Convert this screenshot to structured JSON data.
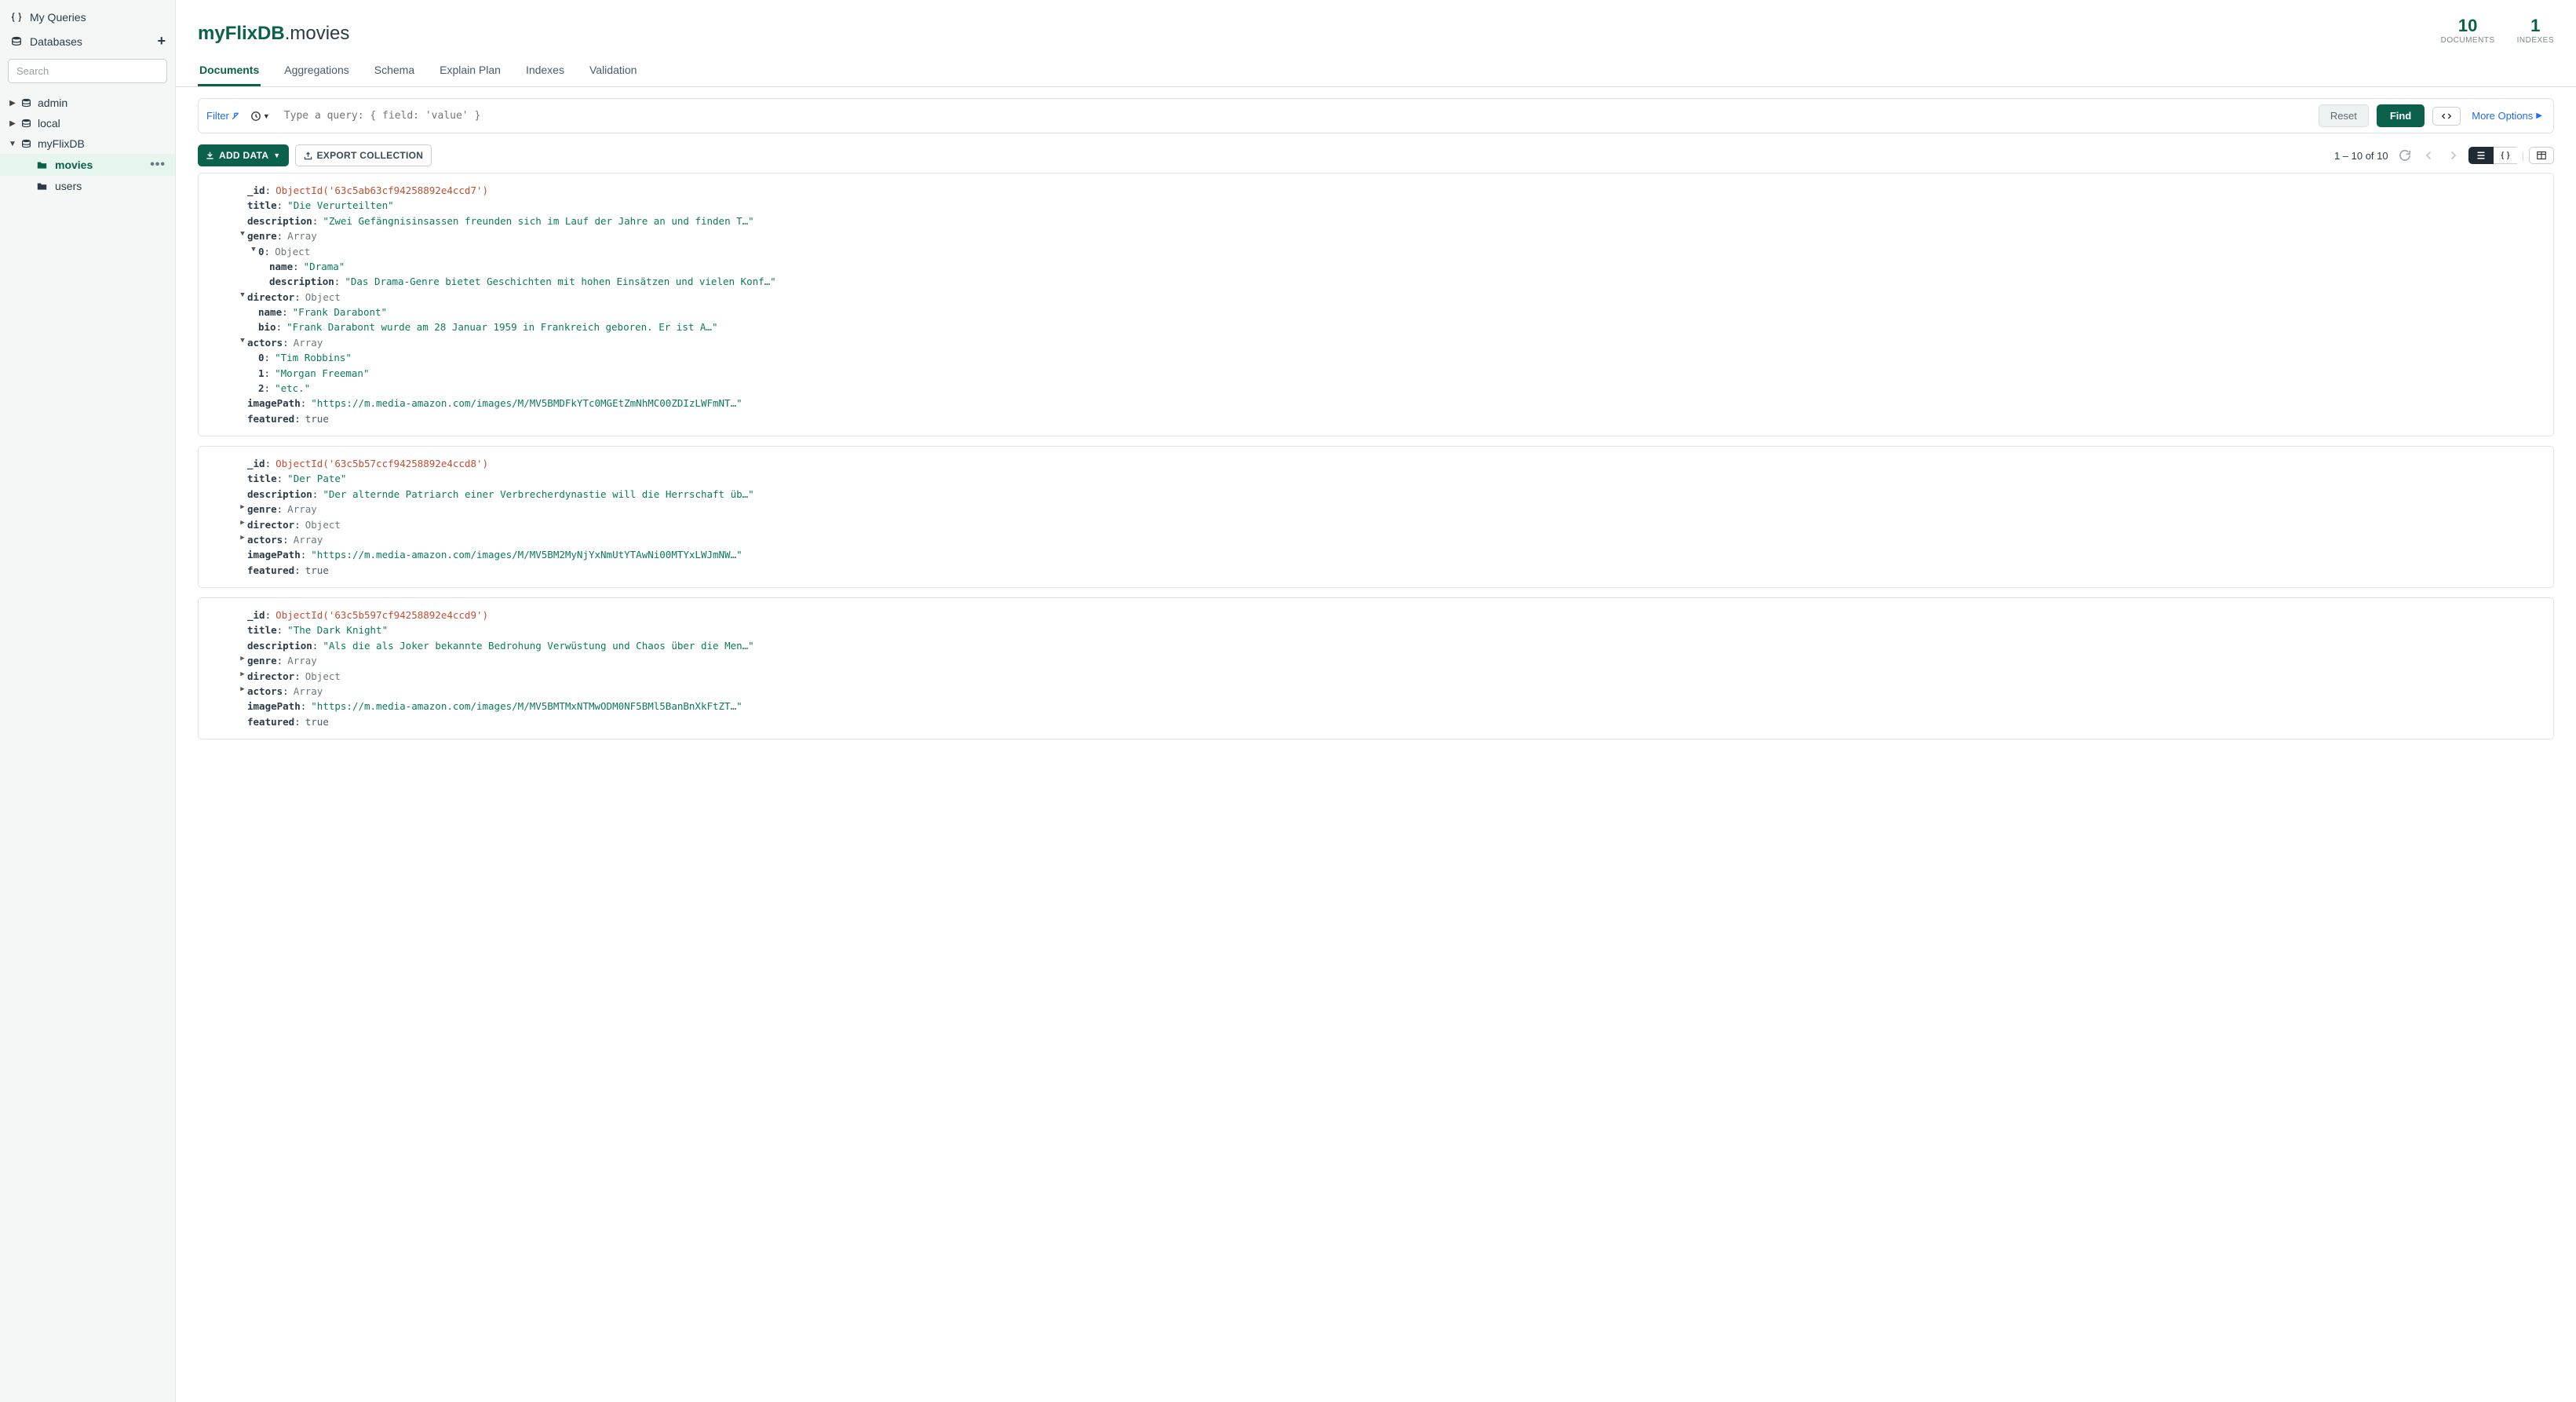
{
  "sidebar": {
    "my_queries": "My Queries",
    "databases": "Databases",
    "search_placeholder": "Search",
    "dbs": [
      "admin",
      "local",
      "myFlixDB"
    ],
    "collections": [
      "movies",
      "users"
    ],
    "active_collection": "movies"
  },
  "header": {
    "db": "myFlixDB",
    "coll": ".movies",
    "documents_count": "10",
    "documents_label": "DOCUMENTS",
    "indexes_count": "1",
    "indexes_label": "INDEXES"
  },
  "tabs": [
    "Documents",
    "Aggregations",
    "Schema",
    "Explain Plan",
    "Indexes",
    "Validation"
  ],
  "querybar": {
    "filter": "Filter",
    "placeholder": "Type a query: { field: 'value' }",
    "reset": "Reset",
    "find": "Find",
    "more": "More Options"
  },
  "toolbar": {
    "add_data": "ADD DATA",
    "export": "EXPORT COLLECTION",
    "range": "1 – 10 of 10"
  },
  "documents": [
    {
      "_id": "ObjectId('63c5ab63cf94258892e4ccd7')",
      "title": "\"Die Verurteilten\"",
      "description": "\"Zwei Gefängnisinsassen freunden sich im Lauf der Jahre an und finden T…\"",
      "genre_type": "Array",
      "genre0_type": "Object",
      "genre0_name": "\"Drama\"",
      "genre0_desc": "\"Das Drama-Genre bietet Geschichten mit hohen Einsätzen und vielen Konf…\"",
      "director_type": "Object",
      "director_name": "\"Frank Darabont\"",
      "director_bio": "\"Frank Darabont wurde am 28 Januar 1959 in Frankreich geboren. Er ist A…\"",
      "actors_type": "Array",
      "actor0": "\"Tim Robbins\"",
      "actor1": "\"Morgan Freeman\"",
      "actor2": "\"etc.\"",
      "imagePath": "\"https://m.media-amazon.com/images/M/MV5BMDFkYTc0MGEtZmNhMC00ZDIzLWFmNT…\"",
      "featured": "true"
    },
    {
      "_id": "ObjectId('63c5b57ccf94258892e4ccd8')",
      "title": "\"Der Pate\"",
      "description": "\"Der alternde Patriarch einer Verbrecherdynastie will die Herrschaft üb…\"",
      "genre_type": "Array",
      "director_type": "Object",
      "actors_type": "Array",
      "imagePath": "\"https://m.media-amazon.com/images/M/MV5BM2MyNjYxNmUtYTAwNi00MTYxLWJmNW…\"",
      "featured": "true"
    },
    {
      "_id": "ObjectId('63c5b597cf94258892e4ccd9')",
      "title": "\"The Dark Knight\"",
      "description": "\"Als die als Joker bekannte Bedrohung Verwüstung und Chaos über die Men…\"",
      "genre_type": "Array",
      "director_type": "Object",
      "actors_type": "Array",
      "imagePath": "\"https://m.media-amazon.com/images/M/MV5BMTMxNTMwODM0NF5BMl5BanBnXkFtZT…\"",
      "featured": "true"
    }
  ]
}
